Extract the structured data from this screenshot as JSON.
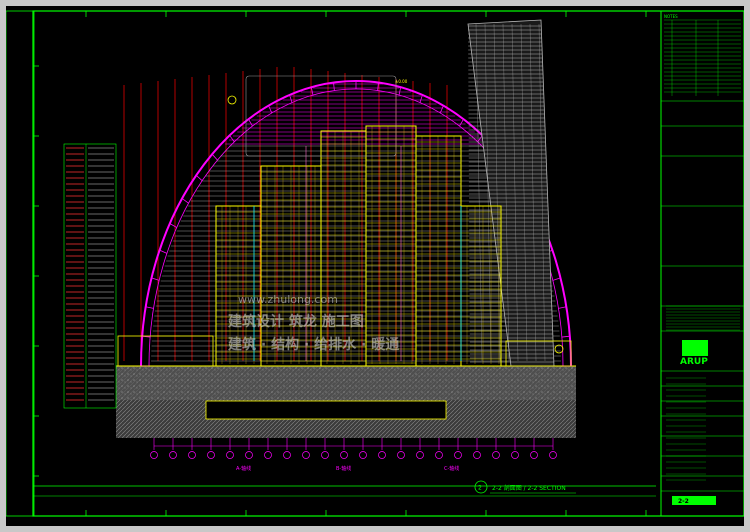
{
  "drawing": {
    "section_title": "2-2 剖面图 / 2-2 SECTION",
    "section_marker": "2",
    "elevation_tag": "±0.00",
    "axis_labels": [
      "A-轴线",
      "B-轴线",
      "C-轴线"
    ]
  },
  "title_block": {
    "company": "ARUP",
    "sheet_code": "2-2",
    "notes_header": "NOTES"
  },
  "watermark": {
    "url": "www.zhulong.com",
    "line1": "建筑设计 筑龙 施工图",
    "line2": "建筑 · 结构 · 给排水 · 暖通"
  },
  "colors": {
    "frame_green": "#00ff00",
    "dome_magenta": "#ff00ff",
    "structure_yellow": "#ffff00",
    "grid_red": "#ff0000",
    "tower_gray": "#b4b4b4",
    "ground_hatch": "#7a7a7a"
  }
}
